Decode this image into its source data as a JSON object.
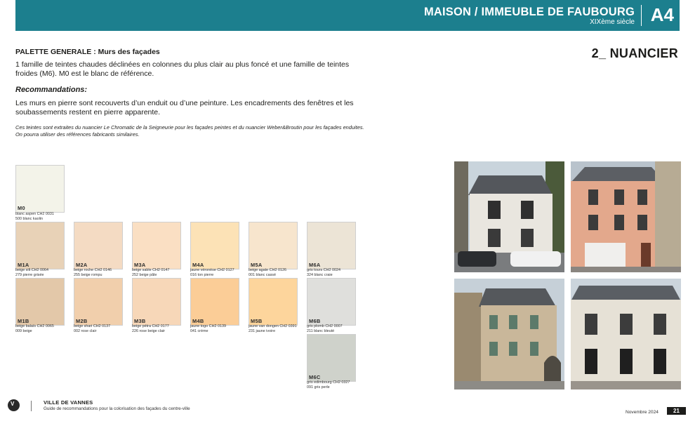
{
  "header": {
    "title": "MAISON / IMMEUBLE DE FAUBOURG",
    "subtitle": "XIXème siècle",
    "code": "A4",
    "bg_color": "#1c7f8e"
  },
  "section": {
    "label": "2_ NUANCIER"
  },
  "text": {
    "palette_title": "PALETTE GENERALE : Murs des façades",
    "palette_desc": "1 famille de teintes chaudes déclinées en colonnes du plus clair au plus foncé et une famille de teintes froides (M6). M0 est le blanc de référence.",
    "reco_title": "Recommandations:",
    "reco_desc": "Les murs en pierre sont recouverts d’un enduit ou d’une peinture. Les encadrements des fenêtres et les soubassements restent en pierre apparente.",
    "source_note": "Ces teintes sont extraites du nuancier Le Chromatic de la Seigneurie pour les façades peintes et du nuancier Weber&Broutin pour les façades enduites. On pourra utiliser des références fabricants similaires."
  },
  "swatches": [
    {
      "code": "M0",
      "color": "#f3f3e9",
      "line1": "blanc aspen CH2 0031",
      "line2": "500 blanc kaolin"
    },
    {
      "code": "M1A",
      "color": "#e8d2b7",
      "line1": "beige silt CH2 0064",
      "line2": "279 pierre grisée"
    },
    {
      "code": "M2A",
      "color": "#f4dbc3",
      "line1": "beige roche CH2 0146",
      "line2": "255 beige rompu"
    },
    {
      "code": "M3A",
      "color": "#fadfc3",
      "line1": "beige sable CH2 0147",
      "line2": "252 beige pâle"
    },
    {
      "code": "M4A",
      "color": "#fce2b6",
      "line1": "jaune véronèse CH2 0127",
      "line2": "016 ton pierre"
    },
    {
      "code": "M5A",
      "color": "#f7e5cd",
      "line1": "beige agate CH2 0126",
      "line2": "001 blanc cassé"
    },
    {
      "code": "M6A",
      "color": "#ece4d6",
      "line1": "gris tours CH2 0024",
      "line2": "324 blanc craie"
    },
    {
      "code": "M1B",
      "color": "#e3c8a9",
      "line1": "beige balaïs CH2 0065",
      "line2": "009 beige"
    },
    {
      "code": "M2B",
      "color": "#f1cfac",
      "line1": "beige shari CH2 0137",
      "line2": "002 rose clair"
    },
    {
      "code": "M3B",
      "color": "#f7d7b8",
      "line1": "beige pétra CH2 0177",
      "line2": "226 rose beige clair"
    },
    {
      "code": "M4B",
      "color": "#fbcd97",
      "line1": "jaune togo CH2 0139",
      "line2": "041 crème"
    },
    {
      "code": "M5B",
      "color": "#fdd59c",
      "line1": "jaune van dongen CH2 0391",
      "line2": "231 jaune ivoire"
    },
    {
      "code": "M6B",
      "color": "#dfdfdc",
      "line1": "gris plomb CH2 0007",
      "line2": "211 blanc bleuté"
    },
    {
      "code": "M6C",
      "color": "#cfd2cb",
      "line1": "gris edimbourg CH2 0327",
      "line2": "091 gris perle"
    }
  ],
  "footer": {
    "city": "VILLE DE VANNES",
    "guide": "Guide de recommandations pour la colorisation des façades du centre-ville",
    "date": "Novembre 2024",
    "page": "21",
    "logo_letter": "V"
  }
}
